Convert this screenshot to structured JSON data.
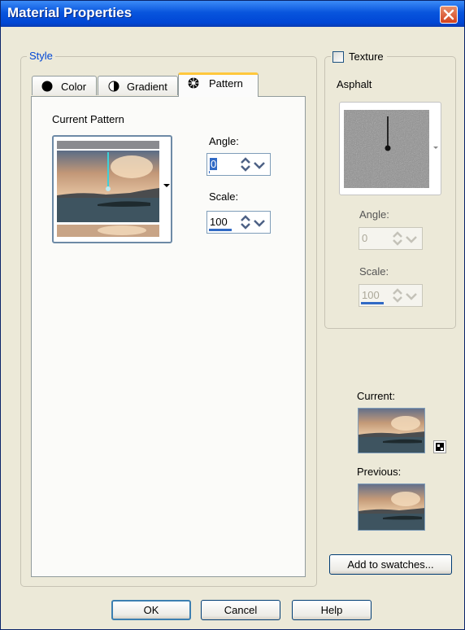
{
  "window": {
    "title": "Material Properties"
  },
  "style_group": {
    "legend": "Style",
    "tabs": [
      {
        "label": "Color",
        "icon": "color-dot-icon"
      },
      {
        "label": "Gradient",
        "icon": "gradient-icon"
      },
      {
        "label": "Pattern",
        "icon": "pattern-icon"
      }
    ],
    "active_tab": "Pattern",
    "pattern": {
      "current_label": "Current Pattern",
      "angle_label": "Angle:",
      "angle_value": "0",
      "scale_label": "Scale:",
      "scale_value": "100"
    }
  },
  "texture": {
    "checkbox_label": "Texture",
    "checked": false,
    "name": "Asphalt",
    "angle_label": "Angle:",
    "angle_value": "0",
    "scale_label": "Scale:",
    "scale_value": "100"
  },
  "swatches": {
    "current_label": "Current:",
    "previous_label": "Previous:",
    "add_button": "Add to swatches..."
  },
  "buttons": {
    "ok": "OK",
    "cancel": "Cancel",
    "help": "Help"
  },
  "colors": {
    "title_blue": "#0054e3",
    "dialog_bg": "#ece9d8",
    "tab_highlight": "#ffc83c"
  }
}
